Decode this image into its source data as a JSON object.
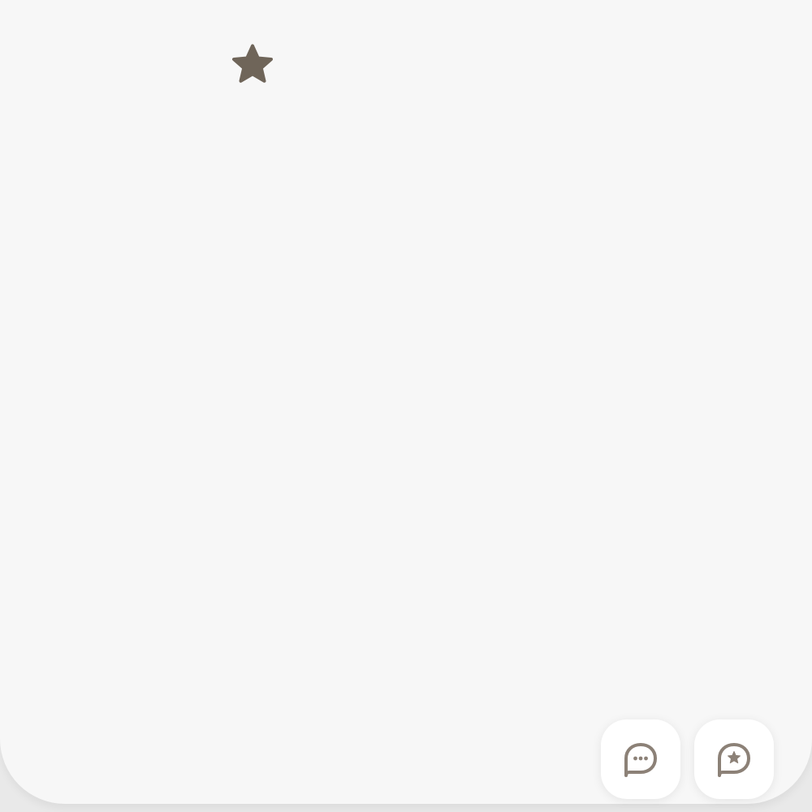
{
  "canvas": {
    "background": "#f7f7f7",
    "outer_background": "#e9e9e9"
  },
  "marker": {
    "icon": "star-icon",
    "color": "#6f6559"
  },
  "actions": [
    {
      "icon": "chat-bubble-dots-icon",
      "color": "#8c8177"
    },
    {
      "icon": "chat-bubble-star-icon",
      "color": "#8c8177"
    }
  ]
}
